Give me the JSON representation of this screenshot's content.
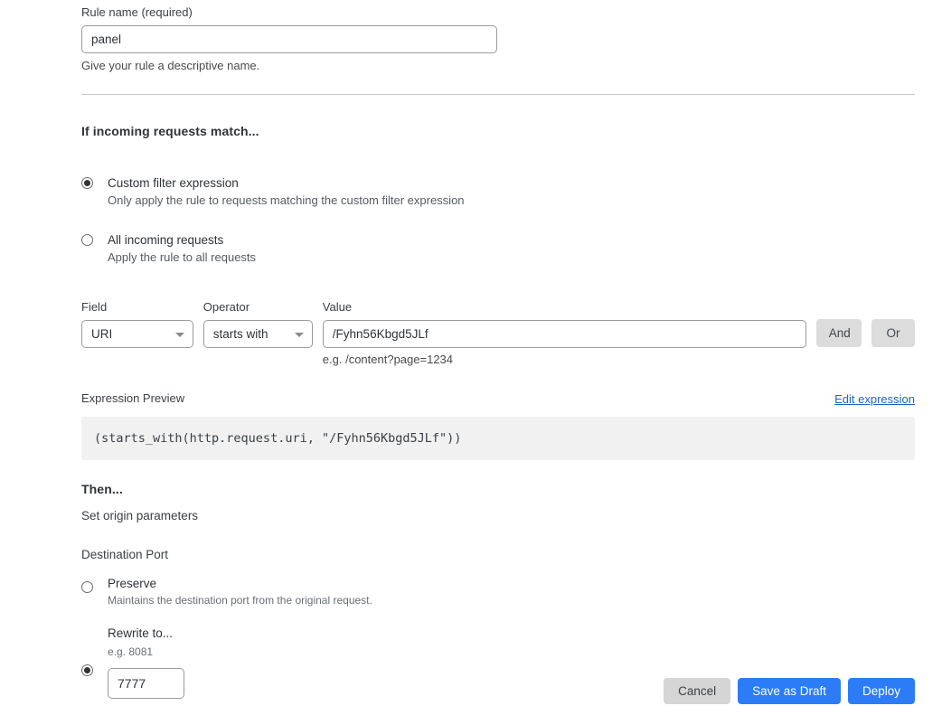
{
  "rule_name": {
    "label": "Rule name (required)",
    "value": "panel",
    "placeholder": "",
    "help": "Give your rule a descriptive name."
  },
  "match_section": {
    "heading": "If incoming requests match...",
    "options": [
      {
        "title": "Custom filter expression",
        "desc": "Only apply the rule to requests matching the custom filter expression",
        "selected": true
      },
      {
        "title": "All incoming requests",
        "desc": "Apply the rule to all requests",
        "selected": false
      }
    ]
  },
  "condition": {
    "field_label": "Field",
    "field_value": "URI",
    "operator_label": "Operator",
    "operator_value": "starts with",
    "value_label": "Value",
    "value_value": "/Fyhn56Kbgd5JLf",
    "value_placeholder": "",
    "value_hint": "e.g. /content?page=1234",
    "and_label": "And",
    "or_label": "Or"
  },
  "expression": {
    "label": "Expression Preview",
    "edit_link": "Edit expression",
    "text": "(starts_with(http.request.uri, \"/Fyhn56Kbgd5JLf\"))"
  },
  "then_section": {
    "heading": "Then...",
    "subheading": "Set origin parameters",
    "port_label": "Destination Port",
    "preserve": {
      "title": "Preserve",
      "desc": "Maintains the destination port from the original request.",
      "selected": false
    },
    "rewrite": {
      "title": "Rewrite to...",
      "hint": "e.g. 8081",
      "value": "7777",
      "placeholder": "",
      "selected": true
    }
  },
  "footer": {
    "cancel_label": "Cancel",
    "save_draft_label": "Save as Draft",
    "deploy_label": "Deploy"
  },
  "colors": {
    "primary": "#2b7cf6",
    "link": "#1f63c8",
    "secondary_btn": "#d5d5d5",
    "expr_bg": "#f1f1f1"
  }
}
